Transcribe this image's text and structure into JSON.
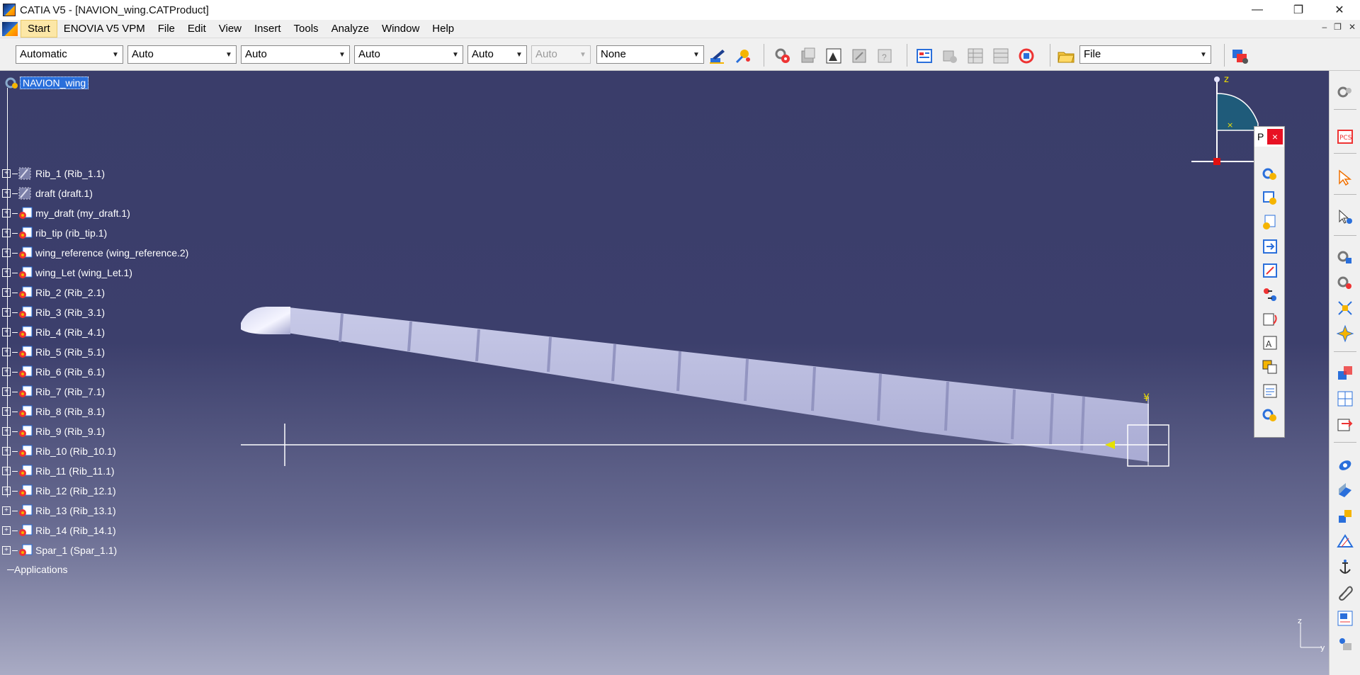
{
  "window": {
    "title": "CATIA V5 - [NAVION_wing.CATProduct]",
    "minimize": "—",
    "restore": "❐",
    "close": "✕"
  },
  "menu": {
    "items": [
      "Start",
      "ENOVIA V5 VPM",
      "File",
      "Edit",
      "View",
      "Insert",
      "Tools",
      "Analyze",
      "Window",
      "Help"
    ],
    "mdi_min": "–",
    "mdi_restore": "❐",
    "mdi_close": "✕"
  },
  "toolbar": {
    "combos": [
      {
        "value": "Automatic",
        "enabled": true
      },
      {
        "value": "Auto",
        "enabled": true
      },
      {
        "value": "Auto",
        "enabled": true
      },
      {
        "value": "Auto",
        "enabled": true
      },
      {
        "value": "Auto",
        "enabled": true
      },
      {
        "value": "Auto",
        "enabled": false
      },
      {
        "value": "None",
        "enabled": true
      }
    ],
    "file_combo": "File"
  },
  "tree": {
    "root": "NAVION_wing",
    "nodes": [
      "Rib_1 (Rib_1.1)",
      "draft (draft.1)",
      "my_draft (my_draft.1)",
      "rib_tip (rib_tip.1)",
      "wing_reference (wing_reference.2)",
      "wing_Let (wing_Let.1)",
      "Rib_2 (Rib_2.1)",
      "Rib_3 (Rib_3.1)",
      "Rib_4 (Rib_4.1)",
      "Rib_5 (Rib_5.1)",
      "Rib_6 (Rib_6.1)",
      "Rib_7 (Rib_7.1)",
      "Rib_8 (Rib_8.1)",
      "Rib_9 (Rib_9.1)",
      "Rib_10 (Rib_10.1)",
      "Rib_11 (Rib_11.1)",
      "Rib_12 (Rib_12.1)",
      "Rib_13 (Rib_13.1)",
      "Rib_14 (Rib_14.1)",
      "Spar_1 (Spar_1.1)"
    ],
    "applications": "Applications"
  },
  "float_panel": {
    "title": "P",
    "close": "×"
  },
  "compass": {
    "z_label": "z"
  },
  "axis_triad": {
    "z_label": "z",
    "y_label": "y"
  },
  "colors": {
    "viewport_top": "#3a3d6a",
    "wing_surface": "#b9bbe0",
    "tree_highlight": "#2a6fdb",
    "menu_active": "#fce7a7"
  }
}
